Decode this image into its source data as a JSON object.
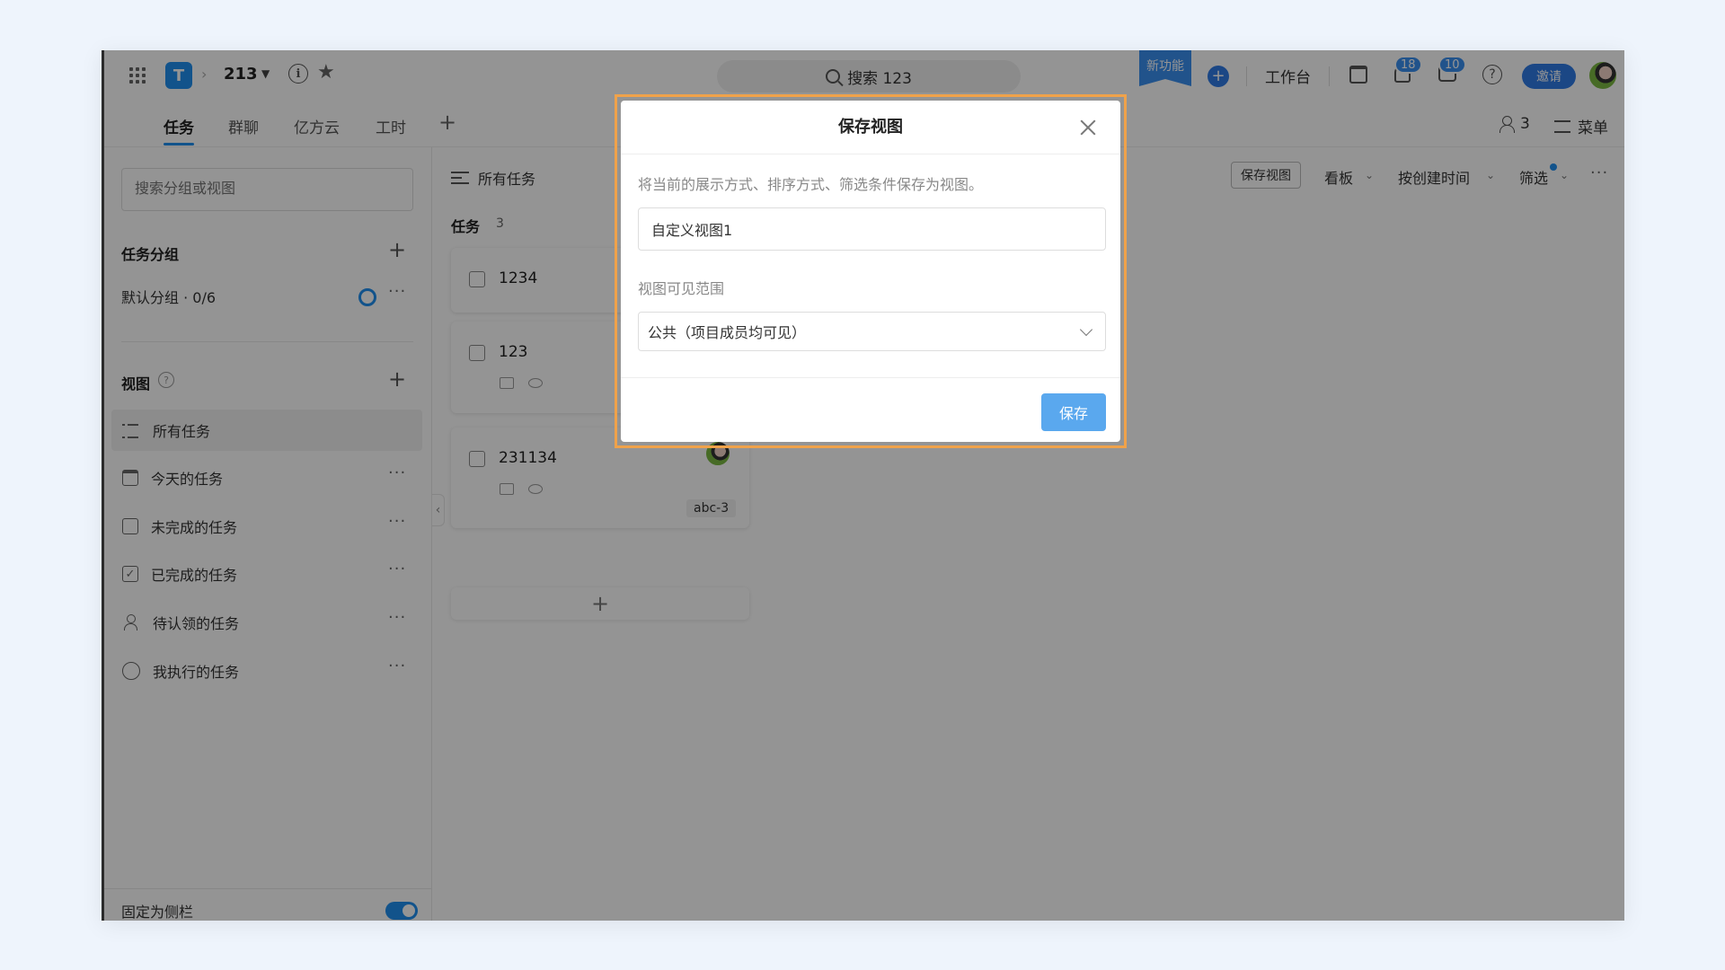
{
  "topbar": {
    "project_name": "213",
    "search_text": "搜索 123",
    "new_feature_label": "新功能",
    "workbench_label": "工作台",
    "notification_count": "18",
    "message_count": "10",
    "invite_label": "邀请",
    "logo_letter": "T"
  },
  "tabs": [
    "任务",
    "群聊",
    "亿方云",
    "工时"
  ],
  "toolbar": {
    "member_count": "3",
    "menu_label": "菜单",
    "save_view_label": "保存视图",
    "board_label": "看板",
    "sort_label": "按创建时间",
    "filter_label": "筛选"
  },
  "sidebar": {
    "search_placeholder": "搜索分组或视图",
    "groups_title": "任务分组",
    "default_group": "默认分组 · 0/6",
    "views_title": "视图",
    "views": [
      "所有任务",
      "今天的任务",
      "未完成的任务",
      "已完成的任务",
      "待认领的任务",
      "我执行的任务"
    ],
    "pin_label": "固定为侧栏"
  },
  "main": {
    "view_title": "所有任务",
    "column_title": "任务",
    "column_count": "3",
    "tasks": [
      {
        "title": "1234"
      },
      {
        "title": "123"
      },
      {
        "title": "231134",
        "tag": "abc-3"
      }
    ]
  },
  "modal": {
    "title": "保存视图",
    "description": "将当前的展示方式、排序方式、筛选条件保存为视图。",
    "name_value": "自定义视图1",
    "scope_label": "视图可见范围",
    "scope_value": "公共（项目成员均可见）",
    "save_label": "保存"
  },
  "colors": {
    "accent": "#1f8ff0",
    "save_button": "#5aa8ee",
    "highlight_border": "#f0a24a"
  }
}
